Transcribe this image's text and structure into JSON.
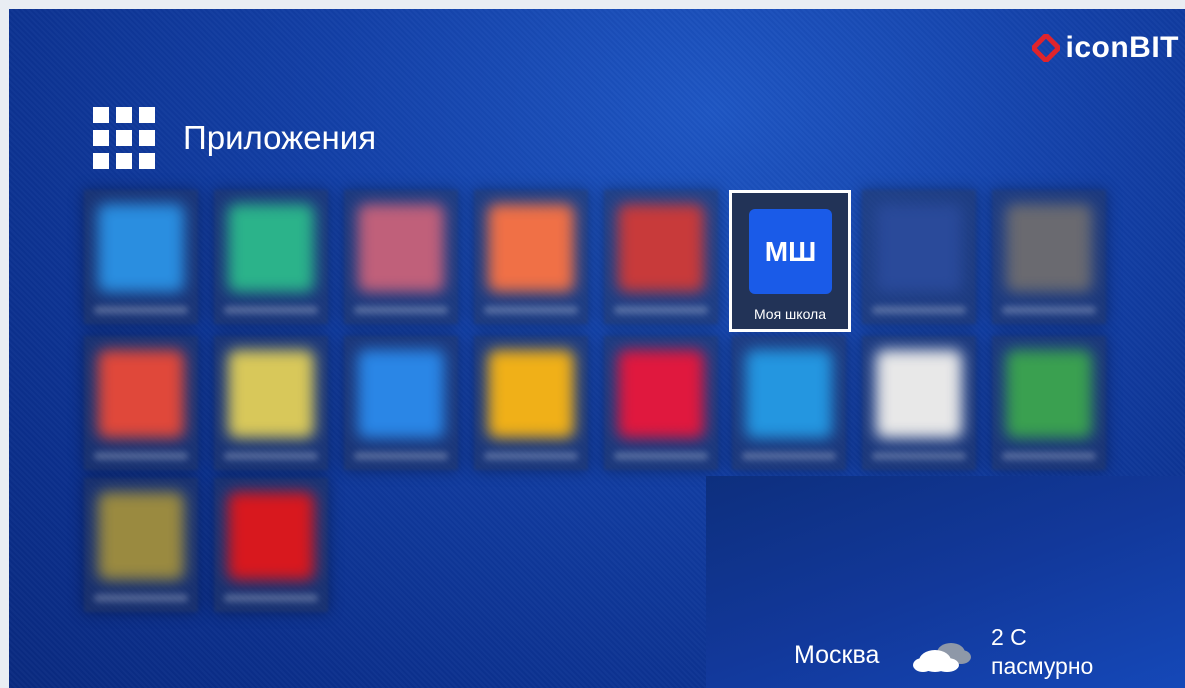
{
  "brand": {
    "logo_text": "iconBIT"
  },
  "apps_section": {
    "title": "Приложения"
  },
  "apps": [
    {
      "label": "",
      "icon": "blurred-app-blue-icon",
      "color": "#2a8ee0",
      "selected": false
    },
    {
      "label": "",
      "icon": "blurred-app-green-icon",
      "color": "#2bb38a",
      "selected": false
    },
    {
      "label": "",
      "icon": "blurred-app-gallery-icon",
      "color": "#c0607a",
      "selected": false
    },
    {
      "label": "",
      "icon": "blurred-app-maps-icon",
      "color": "#f07046",
      "selected": false
    },
    {
      "label": "",
      "icon": "blurred-app-red-icon",
      "color": "#c83a3a",
      "selected": false
    },
    {
      "label": "Моя школа",
      "icon": "my-school-icon",
      "icon_text": "МШ",
      "color": "#1a5be8",
      "selected": true
    },
    {
      "label": "",
      "icon": "blurred-app-dark-icon",
      "color": "#2a4a9a",
      "selected": false
    },
    {
      "label": "",
      "icon": "blurred-app-clock-icon",
      "color": "#6a6a70",
      "selected": false
    },
    {
      "label": "",
      "icon": "blurred-app-video-icon",
      "color": "#e0483a",
      "selected": false
    },
    {
      "label": "",
      "icon": "blurred-app-chrome-icon",
      "color": "#d8c85a",
      "selected": false
    },
    {
      "label": "",
      "icon": "blurred-app-files-icon",
      "color": "#2a86e6",
      "selected": false
    },
    {
      "label": "",
      "icon": "blurred-app-yellow-icon",
      "color": "#f0b018",
      "selected": false
    },
    {
      "label": "",
      "icon": "blurred-app-ivi-icon",
      "color": "#e0183e",
      "selected": false
    },
    {
      "label": "",
      "icon": "blurred-app-lightblue-icon",
      "color": "#2496e0",
      "selected": false
    },
    {
      "label": "",
      "icon": "blurred-app-playstore-icon",
      "color": "#e8e8e8",
      "selected": false
    },
    {
      "label": "",
      "icon": "blurred-app-multicolor-icon",
      "color": "#3aa050",
      "selected": false
    },
    {
      "label": "",
      "icon": "blurred-app-media-icon",
      "color": "#9a8a40",
      "selected": false
    },
    {
      "label": "",
      "icon": "blurred-app-youtube-icon",
      "color": "#d8181e",
      "selected": false
    }
  ],
  "weather": {
    "city": "Москва",
    "temperature": "2 C",
    "condition": "пасмурно",
    "icon": "cloud-icon"
  },
  "colors": {
    "background": "#123fa6",
    "accent_red": "#e0242c",
    "focus_border": "#ffffff"
  }
}
